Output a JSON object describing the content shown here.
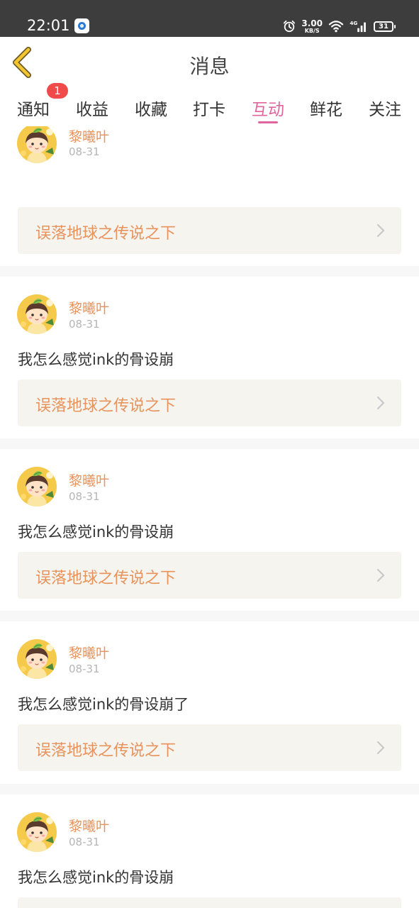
{
  "status_bar": {
    "time": "22:01",
    "net_speed": "3.00",
    "net_unit": "KB/S",
    "network_type": "4G",
    "battery": "31"
  },
  "header": {
    "title": "消息"
  },
  "tabs": [
    {
      "label": "通知",
      "badge": "1"
    },
    {
      "label": "收益"
    },
    {
      "label": "收藏"
    },
    {
      "label": "打卡"
    },
    {
      "label": "互动",
      "active": true
    },
    {
      "label": "鲜花"
    },
    {
      "label": "关注"
    }
  ],
  "feed": {
    "items": [
      {
        "user": "黎曦叶",
        "date": "08-31",
        "comment": "",
        "link": "误落地球之传说之下"
      },
      {
        "user": "黎曦叶",
        "date": "08-31",
        "comment": "我怎么感觉ink的骨设崩",
        "link": "误落地球之传说之下"
      },
      {
        "user": "黎曦叶",
        "date": "08-31",
        "comment": "我怎么感觉ink的骨设崩",
        "link": "误落地球之传说之下"
      },
      {
        "user": "黎曦叶",
        "date": "08-31",
        "comment": "我怎么感觉ink的骨设崩了",
        "link": "误落地球之传说之下"
      },
      {
        "user": "黎曦叶",
        "date": "08-31",
        "comment": "我怎么感觉ink的骨设崩",
        "link": ""
      }
    ]
  },
  "colors": {
    "accent": "#e0659e",
    "username": "#e8935c",
    "link_bg": "#f5f4ee",
    "badge": "#f04a4a",
    "status_bar": "#3d3d3d"
  },
  "icons": {
    "back": "chevron-left-icon",
    "link_arrow": "chevron-right-icon",
    "alarm": "alarm-icon",
    "wifi": "wifi-icon",
    "signal": "signal-icon",
    "battery": "battery-icon"
  }
}
